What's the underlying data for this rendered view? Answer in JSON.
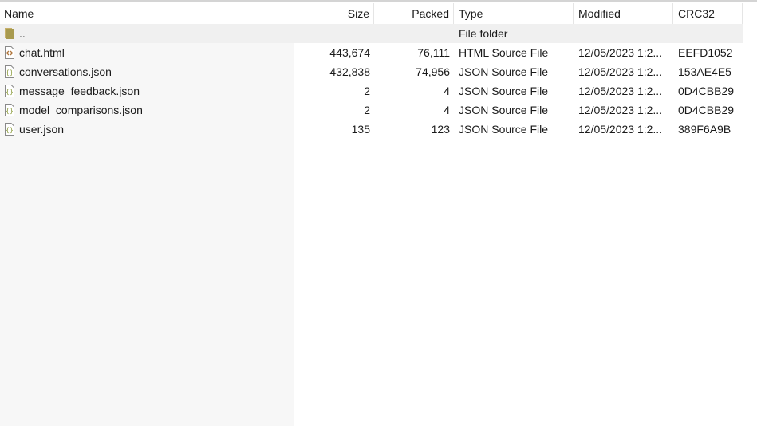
{
  "header": {
    "columns": [
      {
        "key": "name",
        "label": "Name"
      },
      {
        "key": "size",
        "label": "Size"
      },
      {
        "key": "packed",
        "label": "Packed"
      },
      {
        "key": "type",
        "label": "Type"
      },
      {
        "key": "modified",
        "label": "Modified"
      },
      {
        "key": "crc",
        "label": "CRC32"
      }
    ],
    "sort_indicator": "^"
  },
  "rows": [
    {
      "icon": "folder-icon",
      "name": "..",
      "size": "",
      "packed": "",
      "type": "File folder",
      "modified": "",
      "crc": ""
    },
    {
      "icon": "html-file-icon",
      "name": "chat.html",
      "size": "443,674",
      "packed": "76,111",
      "type": "HTML Source File",
      "modified": "12/05/2023 1:2...",
      "crc": "EEFD1052"
    },
    {
      "icon": "json-file-icon",
      "name": "conversations.json",
      "size": "432,838",
      "packed": "74,956",
      "type": "JSON Source File",
      "modified": "12/05/2023 1:2...",
      "crc": "153AE4E5"
    },
    {
      "icon": "json-file-icon",
      "name": "message_feedback.json",
      "size": "2",
      "packed": "4",
      "type": "JSON Source File",
      "modified": "12/05/2023 1:2...",
      "crc": "0D4CBB29"
    },
    {
      "icon": "json-file-icon",
      "name": "model_comparisons.json",
      "size": "2",
      "packed": "4",
      "type": "JSON Source File",
      "modified": "12/05/2023 1:2...",
      "crc": "0D4CBB29"
    },
    {
      "icon": "json-file-icon",
      "name": "user.json",
      "size": "135",
      "packed": "123",
      "type": "JSON Source File",
      "modified": "12/05/2023 1:2...",
      "crc": "389F6A9B"
    }
  ],
  "colors": {
    "folder": "#c7b06a",
    "html_icon": "#b0763c",
    "json_icon": "#8a9a3a",
    "parent_row_bg": "#f0f0f0",
    "name_col_bg": "#f7f7f7"
  }
}
